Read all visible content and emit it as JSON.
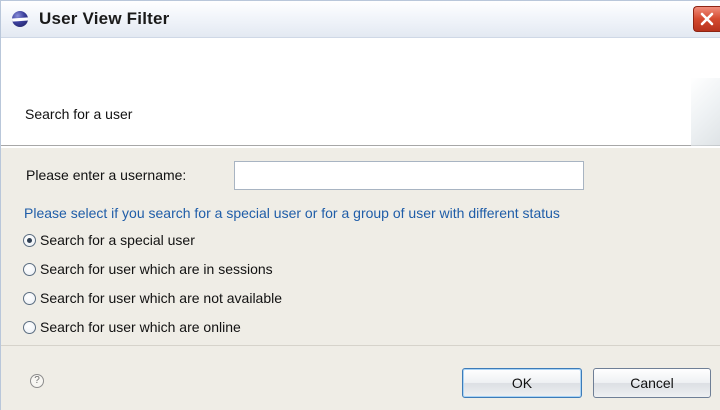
{
  "window": {
    "title": "User View Filter",
    "app_icon": "eclipse-icon",
    "close_icon": "close-icon"
  },
  "header": {
    "message": "Search for a user"
  },
  "form": {
    "username_label": "Please enter a username:",
    "username_value": "",
    "instruction": "Please select if you search for a special user or for a group of user with different status",
    "options": [
      {
        "label": "Search for a special user",
        "checked": true
      },
      {
        "label": "Search for user which are in sessions",
        "checked": false
      },
      {
        "label": "Search for user which are not available",
        "checked": false
      },
      {
        "label": "Search for user which are online",
        "checked": false
      }
    ]
  },
  "footer": {
    "help_icon": "help-icon",
    "help_glyph": "?",
    "ok_label": "OK",
    "cancel_label": "Cancel"
  },
  "colors": {
    "instruction_text": "#1f5da8",
    "close_button": "#d44a2f",
    "dialog_background": "#efede6"
  }
}
